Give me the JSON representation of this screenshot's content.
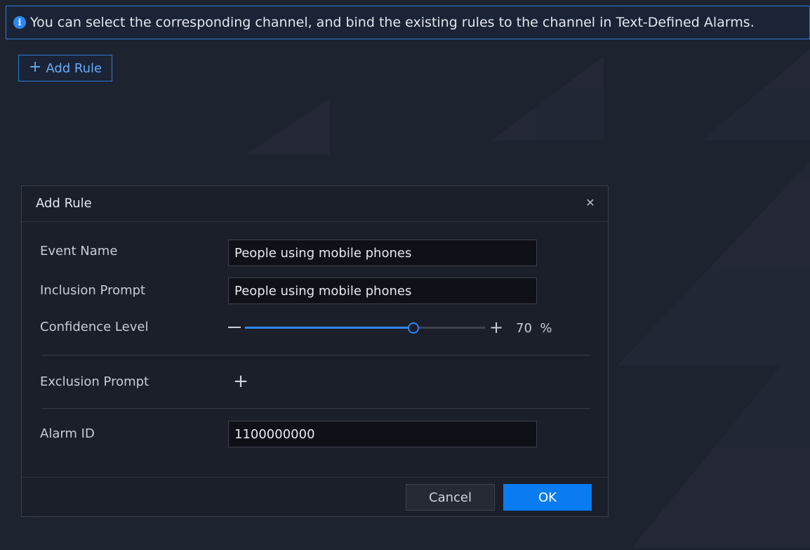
{
  "banner": {
    "icon": "info-icon",
    "text": "You can select the corresponding channel, and bind the existing rules to the channel in Text-Defined Alarms."
  },
  "toolbar": {
    "add_rule_label": "Add Rule"
  },
  "dialog": {
    "title": "Add Rule",
    "close_icon": "close-icon",
    "fields": {
      "event_name": {
        "label": "Event Name",
        "value": "People using mobile phones"
      },
      "inclusion_prompt": {
        "label": "Inclusion Prompt",
        "value": "People using mobile phones"
      },
      "confidence_level": {
        "label": "Confidence Level",
        "value": 70,
        "value_text": "70",
        "unit": "%"
      },
      "exclusion_prompt": {
        "label": "Exclusion Prompt",
        "add_icon": "plus-icon"
      },
      "alarm_id": {
        "label": "Alarm ID",
        "value": "1100000000"
      }
    },
    "buttons": {
      "cancel": "Cancel",
      "ok": "OK"
    }
  },
  "colors": {
    "accent": "#2f86f0",
    "background": "#1e2330",
    "dialog_background": "#1b1f29"
  }
}
